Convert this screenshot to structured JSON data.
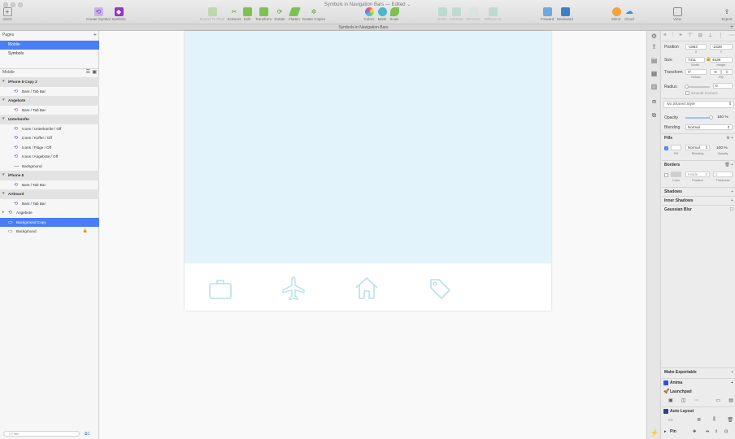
{
  "window": {
    "title": "Symbols in Navigation Bars — Edited ⌄"
  },
  "toolbar": {
    "insert": "Insert",
    "create_symbol": "Create Symbol",
    "symbols": "Symbols",
    "round_to_pixel": "Round To Pixel",
    "scissors": "Scissors",
    "edit": "Edit",
    "transform": "Transform",
    "rotate": "Rotate",
    "flatten": "Flatten",
    "rotate_copies": "Rotate Copies",
    "colors": "Colors",
    "mask": "Mask",
    "scale": "Scale",
    "union": "Union",
    "subtract": "Subtract",
    "intersect": "Intersect",
    "difference": "Difference",
    "forward": "Forward",
    "backward": "Backward",
    "mirror": "Mirror",
    "cloud": "Cloud",
    "view": "View",
    "export": "Export"
  },
  "tabbar": {
    "doc_tab": "Symbols in Navigation Bars",
    "plus": "+"
  },
  "pages": {
    "header": "Pages",
    "add": "+",
    "items": [
      {
        "label": "Mobile",
        "selected": true
      },
      {
        "label": "Symbols",
        "selected": false
      }
    ]
  },
  "layers": {
    "header": "Mobile",
    "rows": [
      {
        "label": "iPhone 8 Copy 2",
        "kind": "group"
      },
      {
        "label": "Bars / Tab Bar",
        "kind": "symbol"
      },
      {
        "label": "Angebote",
        "kind": "group"
      },
      {
        "label": "Bars / Tab Bar",
        "kind": "symbol"
      },
      {
        "label": "Unterkünfte",
        "kind": "group"
      },
      {
        "label": "Icons / Unterkünfte / Off",
        "kind": "symbol"
      },
      {
        "label": "Icons / Koffer / Off",
        "kind": "symbol"
      },
      {
        "label": "Icons / Flüge / Off",
        "kind": "symbol"
      },
      {
        "label": "Icons / Angebote / Off",
        "kind": "symbol"
      },
      {
        "label": "Background",
        "kind": "line"
      },
      {
        "label": "iPhone 8",
        "kind": "group"
      },
      {
        "label": "Bars / Tab Bar",
        "kind": "symbol"
      },
      {
        "label": "Artboard",
        "kind": "group"
      },
      {
        "label": "Bars / Tab Bar",
        "kind": "symbol"
      },
      {
        "label": "Angebote",
        "kind": "top-symbol"
      },
      {
        "label": "Background Copy",
        "kind": "top-rect",
        "selected": true
      },
      {
        "label": "Background",
        "kind": "top-rect-locked"
      }
    ],
    "filter_placeholder": "Filter",
    "filter_count": "1"
  },
  "inspector": {
    "position": {
      "label": "Position",
      "x": "-1884",
      "y": "-1839",
      "x_sub": "X",
      "y_sub": "Y"
    },
    "size": {
      "label": "Size",
      "w": "7311",
      "h": "4539",
      "w_sub": "Width",
      "h_sub": "Height"
    },
    "transform": {
      "label": "Transform",
      "rotate": "0°",
      "rotate_sub": "Rotate",
      "flip_sub": "Flip"
    },
    "radius": {
      "label": "Radius",
      "value": "0",
      "smooth": "Smooth Corners"
    },
    "shared_style": "No Shared Style",
    "opacity": {
      "label": "Opacity",
      "value": "100 %",
      "level": 1.0
    },
    "blending": {
      "label": "Blending",
      "value": "Normal"
    },
    "fills": {
      "label": "Fills",
      "blend": "Normal",
      "opacity": "100 %",
      "sub_fill": "Fill",
      "sub_blending": "Blending",
      "sub_opacity": "Opacity"
    },
    "borders": {
      "label": "Borders",
      "position": "Inside",
      "thickness": "1",
      "sub_color": "Color",
      "sub_position": "Position",
      "sub_thickness": "Thickness"
    },
    "shadows": "Shadows",
    "inner_shadows": "Inner Shadows",
    "gaussian_blur": "Gaussian Blur",
    "make_exportable": "Make Exportable",
    "plugins": {
      "anima": "Anima",
      "launchpad": "Launchpad",
      "auto_layout": "Auto Layout",
      "pin": "Pin"
    }
  },
  "colors": {
    "accent": "#4a7ef5",
    "artboard_bg": "#e2f3fb",
    "icon_stroke": "#b8dff0"
  }
}
